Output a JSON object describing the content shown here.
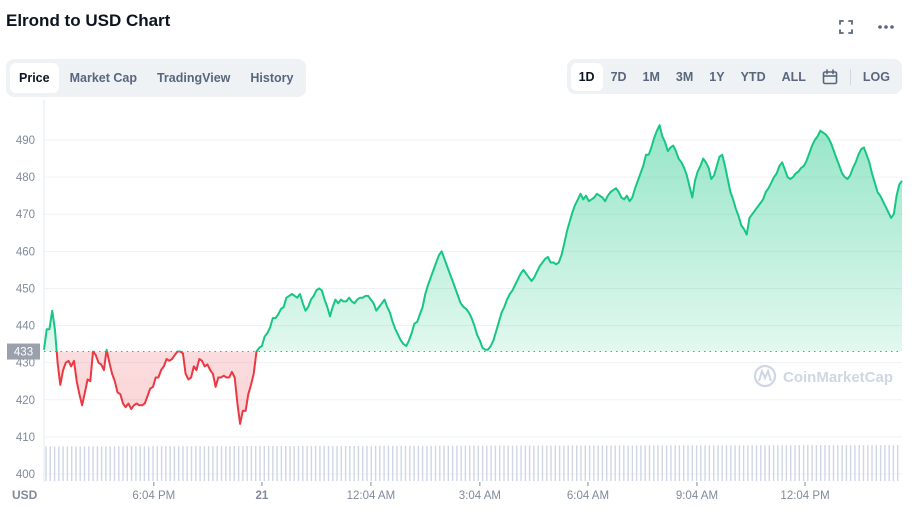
{
  "header": {
    "title": "Elrond to USD Chart",
    "icons": [
      "fullscreen-icon",
      "more-icon"
    ]
  },
  "tabs": [
    {
      "label": "Price",
      "active": true
    },
    {
      "label": "Market Cap",
      "active": false
    },
    {
      "label": "TradingView",
      "active": false
    },
    {
      "label": "History",
      "active": false
    }
  ],
  "ranges": [
    {
      "label": "1D",
      "active": true
    },
    {
      "label": "7D",
      "active": false
    },
    {
      "label": "1M",
      "active": false
    },
    {
      "label": "3M",
      "active": false
    },
    {
      "label": "1Y",
      "active": false
    },
    {
      "label": "YTD",
      "active": false
    },
    {
      "label": "ALL",
      "active": false
    }
  ],
  "log_label": "LOG",
  "watermark": "CoinMarketCap",
  "colors": {
    "up": "#16c784",
    "down": "#ea3943",
    "grid": "#eff2f5",
    "volume": "#cfd6e4",
    "axis_text": "#808a9d"
  },
  "chart_data": {
    "type": "area",
    "title": "Elrond to USD Chart",
    "xlabel": "",
    "ylabel": "USD",
    "currency_label": "USD",
    "ylim": [
      398,
      496
    ],
    "yticks": [
      400,
      410,
      420,
      430,
      440,
      450,
      460,
      470,
      480,
      490
    ],
    "baseline": 433,
    "baseline_label": "433",
    "grid": true,
    "xticks": [
      {
        "label": "6:04 PM",
        "pos": 0.128,
        "bold": false
      },
      {
        "label": "21",
        "pos": 0.254,
        "bold": true
      },
      {
        "label": "12:04 AM",
        "pos": 0.381,
        "bold": false
      },
      {
        "label": "3:04 AM",
        "pos": 0.508,
        "bold": false
      },
      {
        "label": "6:04 AM",
        "pos": 0.634,
        "bold": false
      },
      {
        "label": "9:04 AM",
        "pos": 0.761,
        "bold": false
      },
      {
        "label": "12:04 PM",
        "pos": 0.887,
        "bold": false
      }
    ],
    "series": [
      {
        "name": "Price",
        "values": [
          433.5,
          439,
          439,
          444,
          439,
          430,
          424,
          428,
          430,
          430.5,
          429,
          430.5,
          425,
          421.5,
          418.5,
          422,
          425.5,
          425,
          433,
          432,
          430,
          429.5,
          428,
          433.5,
          430,
          427,
          425,
          422,
          421.5,
          419,
          418,
          419,
          417.5,
          418.5,
          419,
          418.5,
          418.5,
          419,
          421,
          423,
          423.5,
          426,
          426,
          428,
          429,
          431,
          430.5,
          431,
          432,
          433,
          433,
          432.5,
          427,
          425.5,
          426,
          429,
          428,
          431,
          430.5,
          429,
          429.5,
          428,
          427,
          423.5,
          426,
          426,
          426.5,
          426,
          426,
          427.5,
          426,
          419,
          413.5,
          417,
          417,
          421.5,
          424,
          427,
          433,
          434,
          434.5,
          437,
          438,
          439.5,
          442,
          442,
          443,
          444.5,
          445,
          447.5,
          448,
          448.5,
          448,
          447.5,
          448.5,
          446,
          444,
          445,
          447,
          448,
          449.5,
          450,
          449.5,
          447,
          445,
          442.5,
          445,
          447,
          446,
          447,
          446.5,
          446.5,
          447.5,
          446.5,
          446,
          447,
          447.5,
          447.5,
          448,
          448,
          447,
          446,
          444,
          445,
          446,
          447,
          445,
          443.5,
          441,
          439,
          437.5,
          436,
          435,
          434.5,
          436,
          438,
          440.5,
          441,
          443,
          445,
          448.5,
          451,
          453,
          455,
          457,
          459,
          460,
          458,
          456,
          454,
          452,
          450,
          448,
          446,
          445,
          444.5,
          443.5,
          442,
          440,
          437.5,
          436,
          434,
          433.5,
          433.5,
          434.5,
          436,
          438.5,
          441,
          443.5,
          445,
          447,
          448.5,
          449.5,
          451,
          452.5,
          454,
          455,
          454,
          453,
          452,
          453,
          454.5,
          456,
          457,
          458,
          458.5,
          457,
          457,
          456.5,
          457,
          459,
          462,
          465.5,
          468,
          470.5,
          472.5,
          474,
          475.5,
          474,
          475,
          473.5,
          474,
          474.5,
          475.5,
          475,
          474.5,
          473.5,
          475,
          476,
          476.5,
          477,
          476,
          474.5,
          474,
          475,
          473.5,
          474.5,
          477,
          479,
          481,
          483,
          486,
          486,
          488,
          490.5,
          492.5,
          494,
          491,
          489.5,
          487,
          488,
          488.5,
          487,
          485,
          484,
          482.5,
          480.5,
          477.5,
          474.5,
          479,
          481.5,
          483,
          485,
          484,
          482.5,
          479.5,
          480.5,
          483,
          485.5,
          486,
          483,
          479.5,
          476,
          474,
          471.5,
          469.5,
          467,
          466,
          464.5,
          469,
          470,
          471,
          472,
          473,
          474,
          476,
          477,
          478.5,
          480,
          481,
          483,
          484,
          482,
          480,
          479.5,
          480,
          481,
          481.5,
          482.5,
          483,
          484.5,
          486.5,
          488.5,
          490,
          491,
          492.5,
          492,
          491.5,
          490.5,
          489,
          487,
          485,
          483,
          481,
          480,
          479.5,
          480.5,
          482.5,
          484,
          486,
          487.5,
          488,
          486,
          484,
          481,
          478.5,
          476,
          475,
          473.5,
          472,
          470.5,
          469,
          470,
          475,
          478,
          479
        ]
      }
    ],
    "volume": {
      "name": "Volume",
      "relative_values": [
        0.78,
        0.79,
        0.8,
        0.8,
        0.81,
        0.81,
        0.82,
        0.82,
        0.83,
        0.83,
        0.84,
        0.84,
        0.85,
        0.85,
        0.86,
        0.86,
        0.86,
        0.87,
        0.87,
        0.88,
        0.88,
        0.89,
        0.89,
        0.9,
        0.9,
        0.9,
        0.91,
        0.91,
        0.92,
        0.92,
        0.93,
        0.93,
        0.94,
        0.94,
        0.95,
        0.95,
        0.96,
        0.96,
        0.97,
        0.97,
        0.98,
        0.98,
        0.98,
        0.99,
        0.99,
        1.0
      ]
    }
  }
}
